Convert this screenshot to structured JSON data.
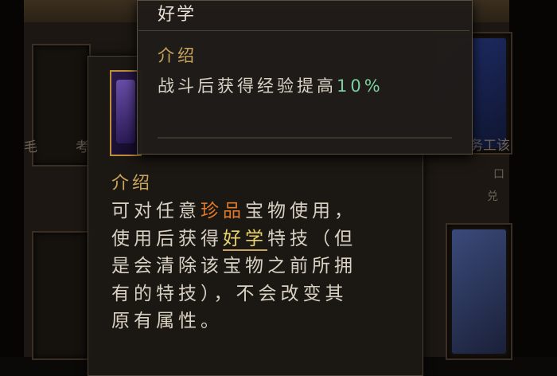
{
  "skill_tooltip": {
    "title": "好学",
    "section_heading": "介绍",
    "desc_prefix": "战斗后获得经验提高",
    "desc_value": "10%"
  },
  "item_tooltip": {
    "section_heading": "介绍",
    "line1_a": "可对任意",
    "line1_highlight": "珍品",
    "line1_b": "宝物使用，",
    "line2_a": "使用后获得",
    "line2_highlight": "好学",
    "line2_b": "特技（但",
    "line3": "是会清除该宝物之前所拥",
    "line4": "有的特技），不会改变其",
    "line5": "原有属性。"
  },
  "background_labels": {
    "left_mid": "毛",
    "left_char": "考",
    "right_mid": "务工该",
    "right_small1": "口",
    "right_small2": "兑"
  },
  "colors": {
    "heading_gold": "#c9a45c",
    "rare_orange": "#e07a2c",
    "skill_yellow": "#e8d36a",
    "value_green": "#7ccfa0"
  }
}
